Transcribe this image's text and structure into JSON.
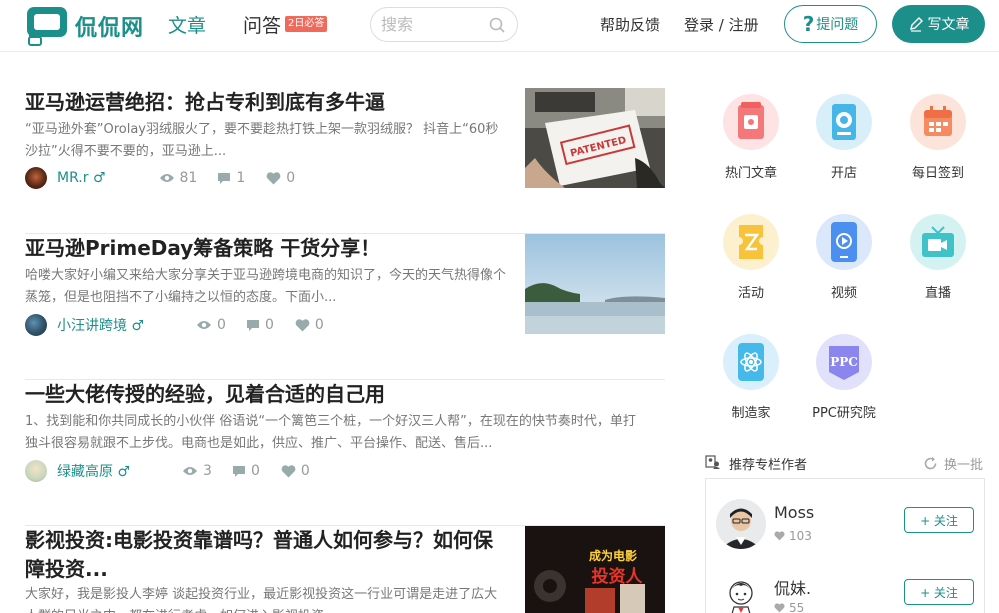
{
  "header": {
    "logo_text": "侃侃网",
    "nav_article": "文章",
    "nav_qa": "问答",
    "qa_badge": "2日必答",
    "search_placeholder": "搜索",
    "help": "帮助反馈",
    "login": "登录 / 注册",
    "ask_label": "提问题",
    "write_label": "写文章",
    "accent": "#1d8f8a"
  },
  "articles": [
    {
      "title": "亚马逊运营绝招：抢占专利到底有多牛逼",
      "desc": "“亚马逊外套”Orolay羽绒服火了，要不要趁热打铁上架一款羽绒服？ 抖音上“60秒沙拉”火得不要不要的，亚马逊上...",
      "author": "MR.r ♂",
      "views": "81",
      "comments": "1",
      "likes": "0",
      "thumb_text": "PATENTED"
    },
    {
      "title": "亚马逊PrimeDay筹备策略 干货分享！",
      "desc": "哈喽大家好小编又来给大家分享关于亚马逊跨境电商的知识了，今天的天气热得像个蒸笼，但是也阻挡不了小编持之以恒的态度。下面小...",
      "author": "小汪讲跨境 ♂",
      "views": "0",
      "comments": "0",
      "likes": "0"
    },
    {
      "title": "一些大佬传授的经验，见着合适的自己用",
      "desc": "1、找到能和你共同成长的小伙伴 俗语说“一个篱笆三个桩，一个好汉三人帮”，在现在的快节奏时代，单打独斗很容易就跟不上步伐。电商也是如此，供应、推广、平台操作、配送、售后...",
      "author": "绿藏高原 ♂",
      "views": "3",
      "comments": "0",
      "likes": "0"
    },
    {
      "title": "影视投资:电影投资靠谱吗？普通人如何参与？如何保障投资...",
      "desc": "大家好，我是影投人李婷 谈起投资行业，最近影视投资这一行业可谓是走进了広大人群的目光之中，都在进行考虑，如何进入影视投资...",
      "thumb_text_1": "成为电影",
      "thumb_text_2": "投资人"
    }
  ],
  "sidebar": {
    "items": [
      {
        "label": "热门文章",
        "icon": "hot-article-icon",
        "color": "#f4787a"
      },
      {
        "label": "开店",
        "icon": "shop-icon",
        "color": "#46b5e8"
      },
      {
        "label": "每日签到",
        "icon": "calendar-checkin-icon",
        "color": "#f58a63"
      },
      {
        "label": "活动",
        "icon": "activity-ticket-icon",
        "color": "#f8c23a"
      },
      {
        "label": "视频",
        "icon": "video-icon",
        "color": "#4b8ff0"
      },
      {
        "label": "直播",
        "icon": "live-tv-icon",
        "color": "#3fc3c8"
      },
      {
        "label": "制造家",
        "icon": "atom-icon",
        "color": "#45b9e9"
      },
      {
        "label": "PPC研究院",
        "icon": "ppc-icon",
        "color": "#8a86ee"
      }
    ],
    "rec_title": "推荐专栏作者",
    "rec_refresh": "换一批",
    "authors": [
      {
        "name": "Moss",
        "likes": "103",
        "follow": "+ 关注"
      },
      {
        "name": "侃妹.",
        "likes": "55",
        "follow": "+ 关注"
      }
    ]
  }
}
